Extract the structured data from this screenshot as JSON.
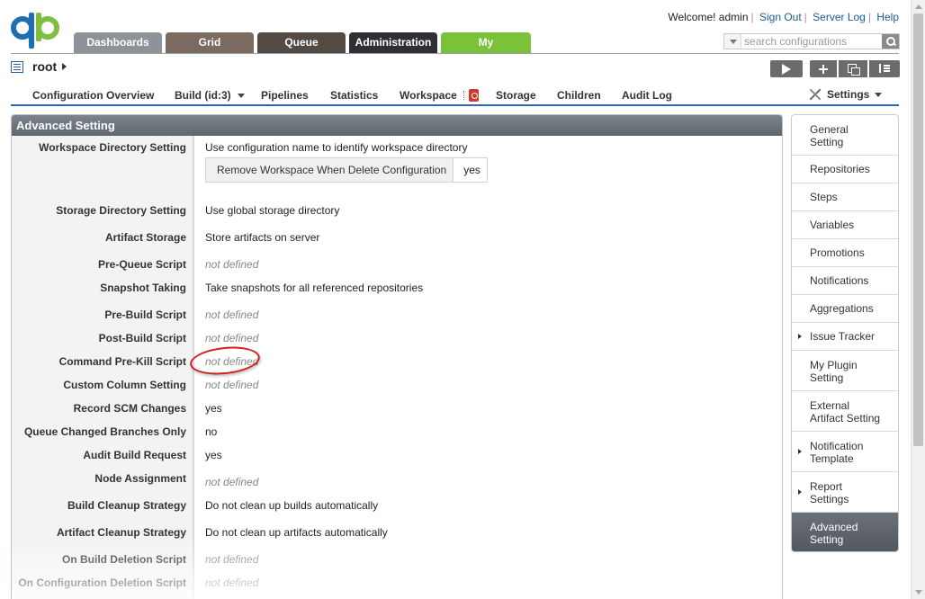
{
  "header": {
    "welcome": "Welcome! admin",
    "sign_out": "Sign Out",
    "server_log": "Server Log",
    "help": "Help",
    "search_placeholder": "search configurations"
  },
  "tabs": [
    "Dashboards",
    "Grid",
    "Queue",
    "Administration",
    "My"
  ],
  "breadcrumb": {
    "name": "root"
  },
  "subnav": {
    "items": [
      "Configuration Overview",
      "Build (id:3)",
      "Pipelines",
      "Statistics",
      "Workspace",
      "Storage",
      "Children",
      "Audit Log"
    ],
    "settings": "Settings"
  },
  "panel": {
    "title": "Advanced Setting",
    "rows": [
      {
        "label": "Workspace Directory Setting",
        "value": "Use configuration name to identify workspace directory"
      },
      {
        "label": "Storage Directory Setting",
        "value": "Use global storage directory"
      },
      {
        "label": "Artifact Storage",
        "value": "Store artifacts on server"
      },
      {
        "label": "Pre-Queue Script",
        "value": "not defined"
      },
      {
        "label": "Snapshot Taking",
        "value": "Take snapshots for all referenced repositories"
      },
      {
        "label": "Pre-Build Script",
        "value": "not defined"
      },
      {
        "label": "Post-Build Script",
        "value": "not defined"
      },
      {
        "label": "Command Pre-Kill Script",
        "value": "not defined"
      },
      {
        "label": "Custom Column Setting",
        "value": "not defined"
      },
      {
        "label": "Record SCM Changes",
        "value": "yes"
      },
      {
        "label": "Queue Changed Branches Only",
        "value": "no"
      },
      {
        "label": "Audit Build Request",
        "value": "yes"
      },
      {
        "label": "Node Assignment",
        "value": "not defined"
      },
      {
        "label": "Build Cleanup Strategy",
        "value": "Do not clean up builds automatically"
      },
      {
        "label": "Artifact Cleanup Strategy",
        "value": "Do not clean up artifacts automatically"
      },
      {
        "label": "On Build Deletion Script",
        "value": "not defined"
      },
      {
        "label": "On Configuration Deletion Script",
        "value": "not defined"
      }
    ],
    "workspace_sub": {
      "key": "Remove Workspace When Delete Configuration",
      "value": "yes"
    }
  },
  "sidenav": [
    {
      "label": "General\nSetting"
    },
    {
      "label": "Repositories"
    },
    {
      "label": "Steps"
    },
    {
      "label": "Variables"
    },
    {
      "label": "Promotions"
    },
    {
      "label": "Notifications"
    },
    {
      "label": "Aggregations"
    },
    {
      "label": "Issue Tracker"
    },
    {
      "label": "My Plugin\nSetting"
    },
    {
      "label": "External\nArtifact Setting"
    },
    {
      "label": "Notification\nTemplate"
    },
    {
      "label": "Report\nSettings"
    },
    {
      "label": "Advanced\nSetting"
    }
  ]
}
